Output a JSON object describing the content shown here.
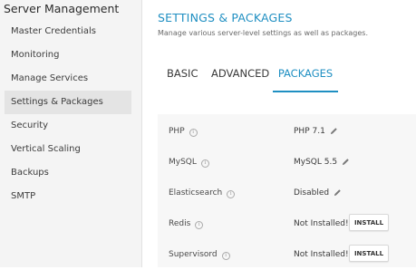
{
  "sidebar": {
    "title": "Server Management",
    "items": [
      {
        "label": "Master Credentials"
      },
      {
        "label": "Monitoring"
      },
      {
        "label": "Manage Services"
      },
      {
        "label": "Settings & Packages"
      },
      {
        "label": "Security"
      },
      {
        "label": "Vertical Scaling"
      },
      {
        "label": "Backups"
      },
      {
        "label": "SMTP"
      }
    ],
    "active_item": "Settings & Packages"
  },
  "main": {
    "title": "SETTINGS & PACKAGES",
    "subtitle": "Manage various server-level settings as well as packages.",
    "tabs": [
      {
        "label": "BASIC"
      },
      {
        "label": "ADVANCED"
      },
      {
        "label": "PACKAGES"
      }
    ],
    "active_tab": "PACKAGES",
    "packages": [
      {
        "name": "PHP",
        "value": "PHP 7.1"
      },
      {
        "name": "MySQL",
        "value": "MySQL 5.5"
      },
      {
        "name": "Elasticsearch",
        "value": "Disabled"
      },
      {
        "name": "Redis",
        "value": "Not Installed!",
        "action": "INSTALL"
      },
      {
        "name": "Supervisord",
        "value": "Not Installed!",
        "action": "INSTALL"
      }
    ]
  },
  "icons": {
    "info": "info-circle-icon",
    "edit": "pencil-icon",
    "info_glyph": "i"
  },
  "colors": {
    "accent": "#1f8fc2",
    "sidebar_bg": "#f4f4f4",
    "active_item_bg": "#e4e4e4",
    "panel_bg": "#f7f7f7"
  }
}
